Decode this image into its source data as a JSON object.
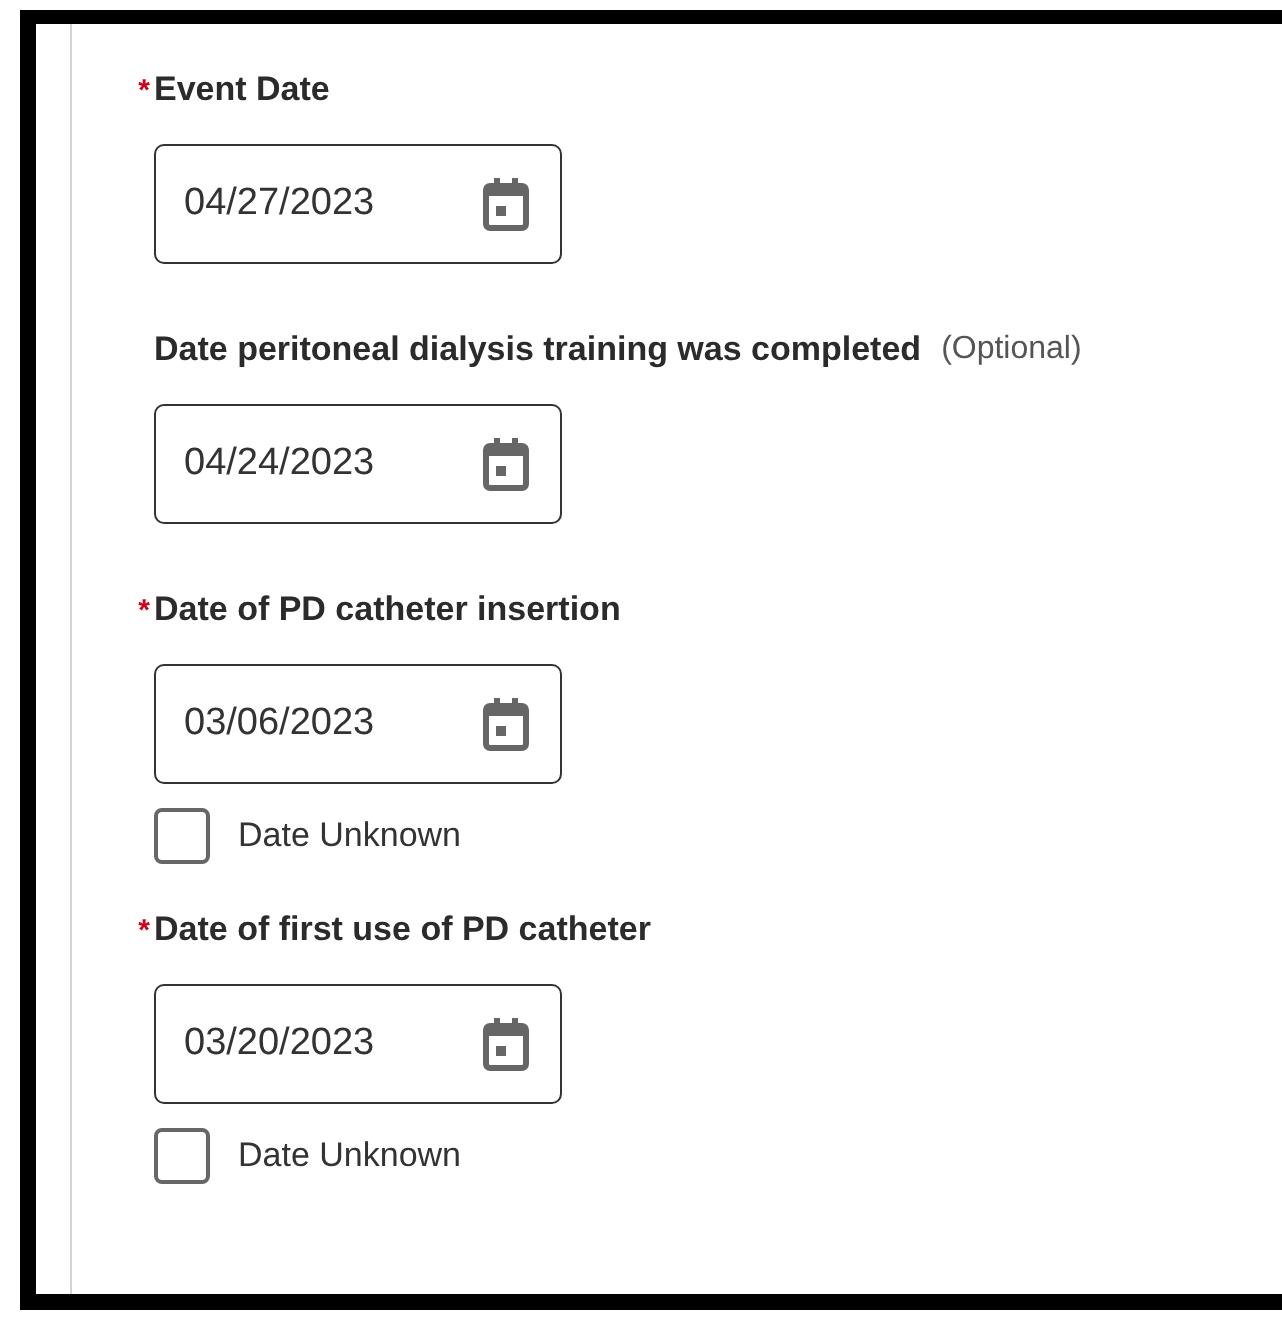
{
  "fields": [
    {
      "label": "Event Date",
      "required_mark": "*",
      "value": "04/27/2023"
    },
    {
      "label": "Date peritoneal dialysis training was completed",
      "optional_note": "(Optional)",
      "value": "04/24/2023"
    },
    {
      "label": "Date of PD catheter insertion",
      "required_mark": "*",
      "value": "03/06/2023",
      "unknown": {
        "label": "Date Unknown",
        "checked": false
      }
    },
    {
      "label": "Date of first use of PD catheter",
      "required_mark": "*",
      "value": "03/20/2023",
      "unknown": {
        "label": "Date Unknown",
        "checked": false
      }
    }
  ]
}
